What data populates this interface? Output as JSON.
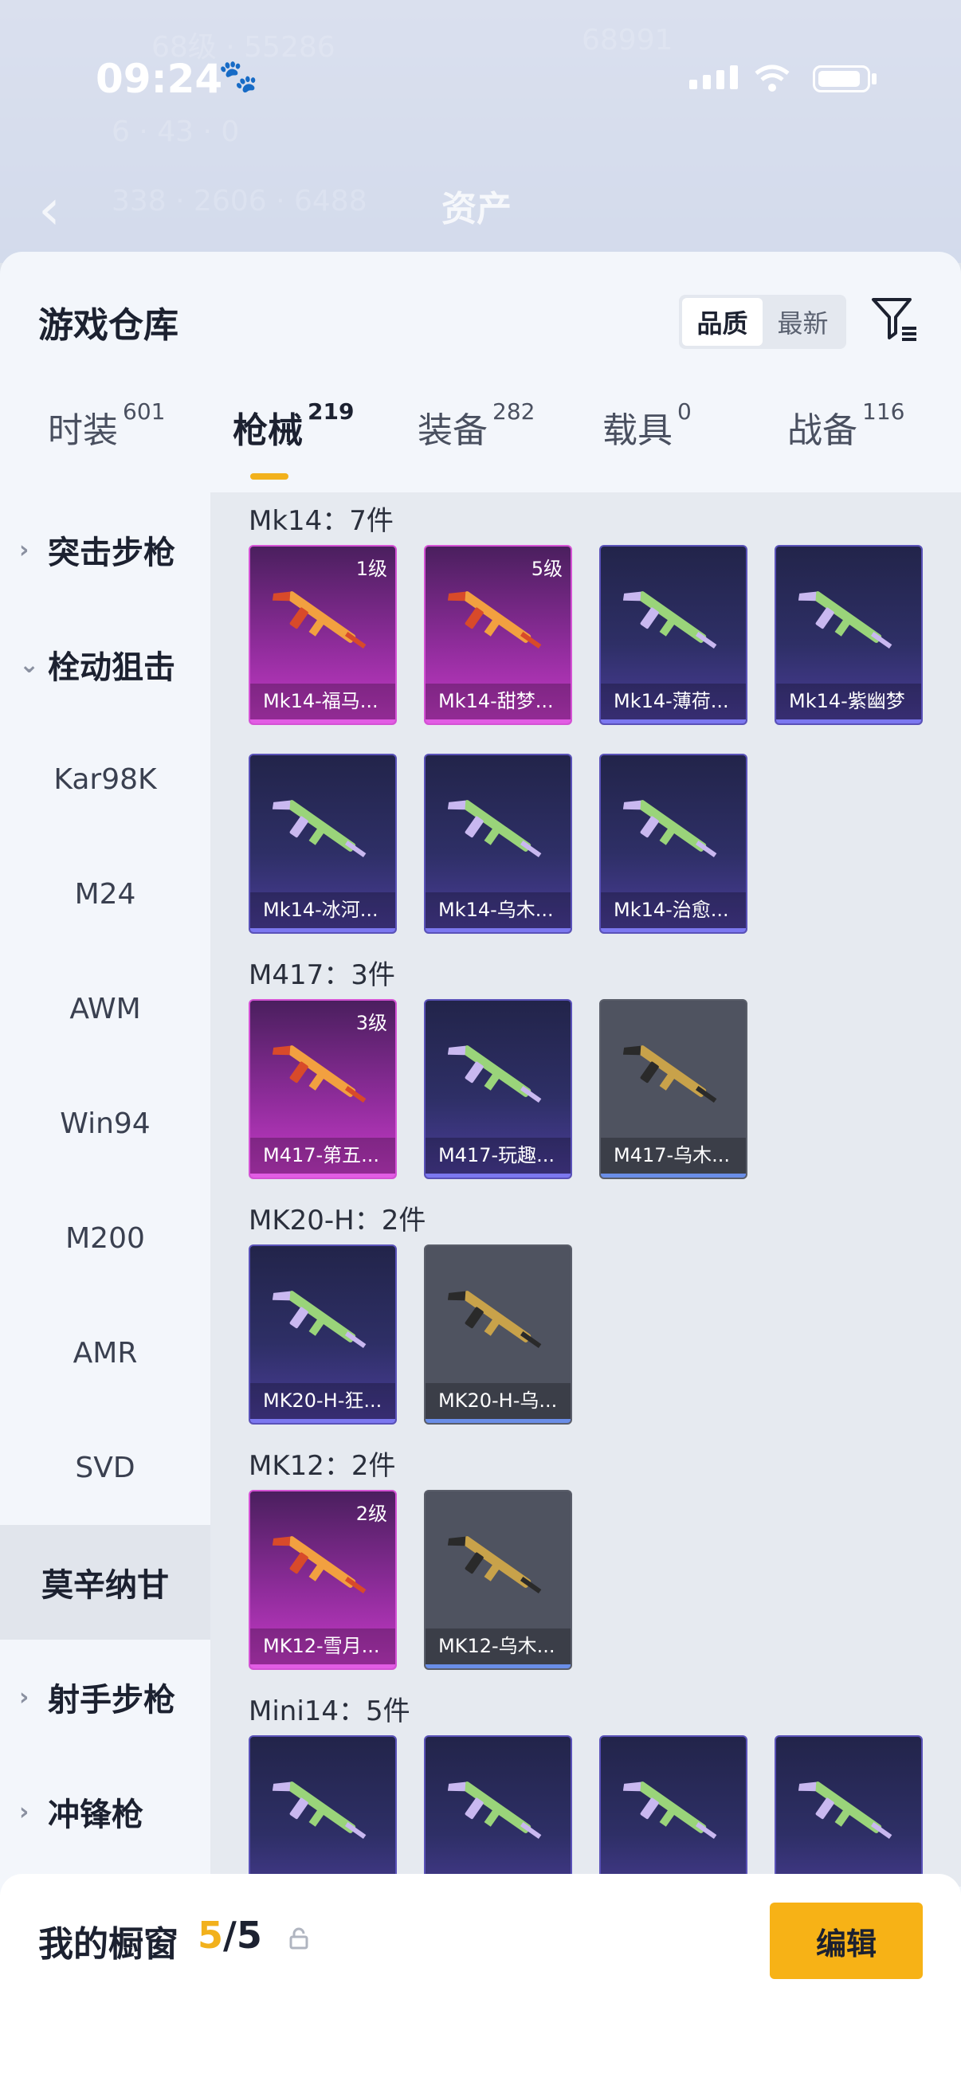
{
  "status_bar": {
    "time": "09:24"
  },
  "header": {
    "back_title": "资产"
  },
  "panel": {
    "title": "游戏仓库",
    "sort_options": [
      {
        "label": "品质",
        "active": true
      },
      {
        "label": "最新",
        "active": false
      }
    ]
  },
  "tabs": [
    {
      "label": "时装",
      "count": "601"
    },
    {
      "label": "枪械",
      "count": "219",
      "active": true
    },
    {
      "label": "装备",
      "count": "282"
    },
    {
      "label": "载具",
      "count": "0"
    },
    {
      "label": "战备",
      "count": "116"
    }
  ],
  "sidebar": {
    "items": [
      {
        "label": "突击步枪",
        "type": "group",
        "chevron": "chevron-right-icon"
      },
      {
        "label": "栓动狙击",
        "type": "group",
        "chevron": "chevron-down-icon"
      },
      {
        "label": "Kar98K",
        "type": "item"
      },
      {
        "label": "M24",
        "type": "item"
      },
      {
        "label": "AWM",
        "type": "item"
      },
      {
        "label": "Win94",
        "type": "item"
      },
      {
        "label": "M200",
        "type": "item"
      },
      {
        "label": "AMR",
        "type": "item"
      },
      {
        "label": "SVD",
        "type": "item"
      },
      {
        "label": "莫辛纳甘",
        "type": "item",
        "selected": true
      },
      {
        "label": "射手步枪",
        "type": "group",
        "chevron": "chevron-right-icon"
      },
      {
        "label": "冲锋枪",
        "type": "group",
        "chevron": "chevron-right-icon"
      }
    ]
  },
  "categories": [
    {
      "title": "Mk14：7件",
      "items": [
        {
          "name": "Mk14-福马...",
          "rarity": "pink",
          "level": "1级"
        },
        {
          "name": "Mk14-甜梦...",
          "rarity": "pink",
          "level": "5级"
        },
        {
          "name": "Mk14-薄荷...",
          "rarity": "purple",
          "level": ""
        },
        {
          "name": "Mk14-紫幽梦",
          "rarity": "purple",
          "level": ""
        },
        {
          "name": "Mk14-冰河...",
          "rarity": "purple",
          "level": ""
        },
        {
          "name": "Mk14-乌木...",
          "rarity": "purple",
          "level": ""
        },
        {
          "name": "Mk14-治愈...",
          "rarity": "purple",
          "level": ""
        }
      ]
    },
    {
      "title": "M417：3件",
      "items": [
        {
          "name": "M417-第五...",
          "rarity": "pink",
          "level": "3级"
        },
        {
          "name": "M417-玩趣...",
          "rarity": "purple",
          "level": ""
        },
        {
          "name": "M417-乌木...",
          "rarity": "gray",
          "level": ""
        }
      ]
    },
    {
      "title": "MK20-H：2件",
      "items": [
        {
          "name": "MK20-H-狂...",
          "rarity": "purple",
          "level": ""
        },
        {
          "name": "MK20-H-乌...",
          "rarity": "gray",
          "level": ""
        }
      ]
    },
    {
      "title": "MK12：2件",
      "items": [
        {
          "name": "MK12-雪月...",
          "rarity": "pink",
          "level": "2级"
        },
        {
          "name": "MK12-乌木...",
          "rarity": "gray",
          "level": ""
        }
      ]
    },
    {
      "title": "Mini14：5件",
      "items": [
        {
          "name": "",
          "rarity": "purple",
          "level": ""
        },
        {
          "name": "",
          "rarity": "purple",
          "level": ""
        },
        {
          "name": "",
          "rarity": "purple",
          "level": ""
        },
        {
          "name": "",
          "rarity": "purple",
          "level": ""
        }
      ]
    }
  ],
  "showcase": {
    "title": "我的橱窗",
    "current": "5",
    "separator": "/",
    "total": "5",
    "edit_label": "编辑"
  },
  "colors": {
    "accent": "#f7b216",
    "pink_rarity": "#c63ac8",
    "purple_rarity": "#4b3d9a",
    "gray_rarity": "#4f5360"
  },
  "icons": [
    "back-chevron-icon",
    "filter-icon",
    "share-export-icon",
    "lock-icon",
    "paw-icon",
    "signal-icon",
    "wifi-icon",
    "battery-icon"
  ]
}
